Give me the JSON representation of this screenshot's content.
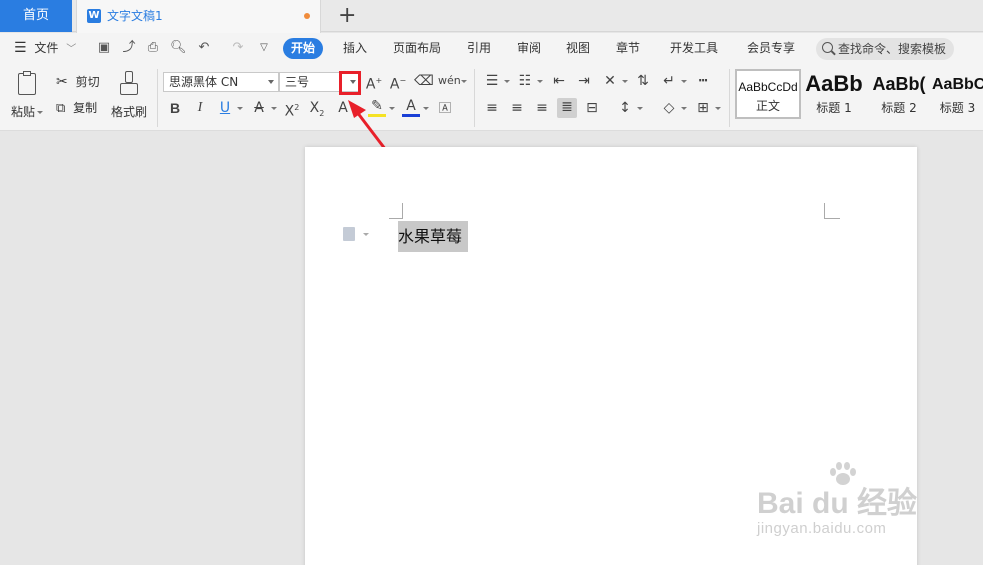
{
  "tabs": {
    "home": "首页",
    "document": "文字文稿1"
  },
  "menu": {
    "file": "文件",
    "tabs": [
      "开始",
      "插入",
      "页面布局",
      "引用",
      "审阅",
      "视图",
      "章节",
      "开发工具",
      "会员专享"
    ],
    "search_placeholder": "查找命令、搜索模板"
  },
  "ribbon": {
    "paste": "粘贴",
    "cut": "剪切",
    "copy": "复制",
    "format_painter": "格式刷",
    "font_name": "思源黑体 CN",
    "font_size": "三号",
    "styles": [
      {
        "sample": "AaBbCcDd",
        "name": "正文"
      },
      {
        "sample": "AaBb",
        "name": "标题 1"
      },
      {
        "sample": "AaBb(",
        "name": "标题 2"
      },
      {
        "sample": "AaBbC",
        "name": "标题 3"
      }
    ]
  },
  "document": {
    "text": "水果草莓"
  },
  "watermark": {
    "brand": "Bai du 经验",
    "url": "jingyan.baidu.com"
  },
  "colors": {
    "accent": "#2a7de1",
    "highlight_box": "#e8202a",
    "modified_dot": "#f08c3c"
  }
}
